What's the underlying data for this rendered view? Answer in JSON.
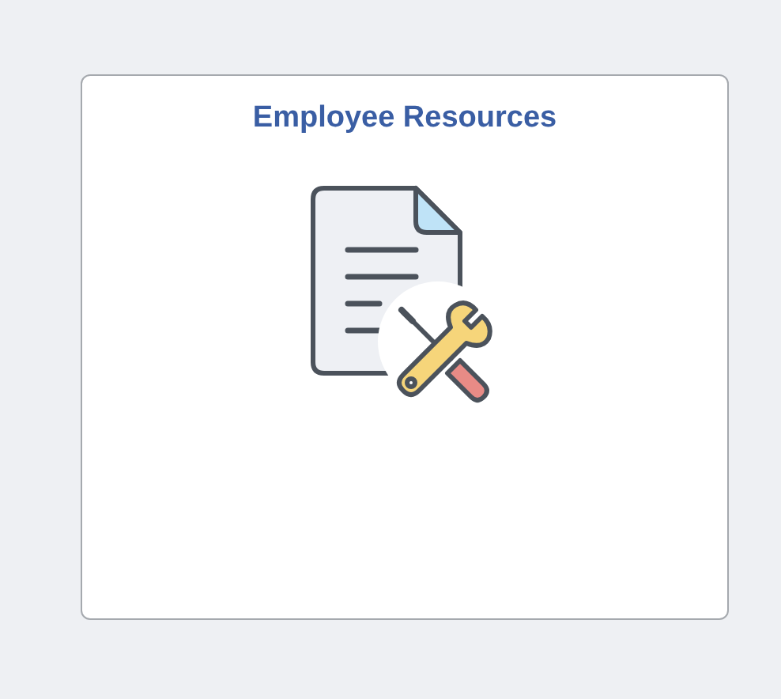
{
  "tiles": [
    {
      "title": "Employee Resources"
    }
  ]
}
